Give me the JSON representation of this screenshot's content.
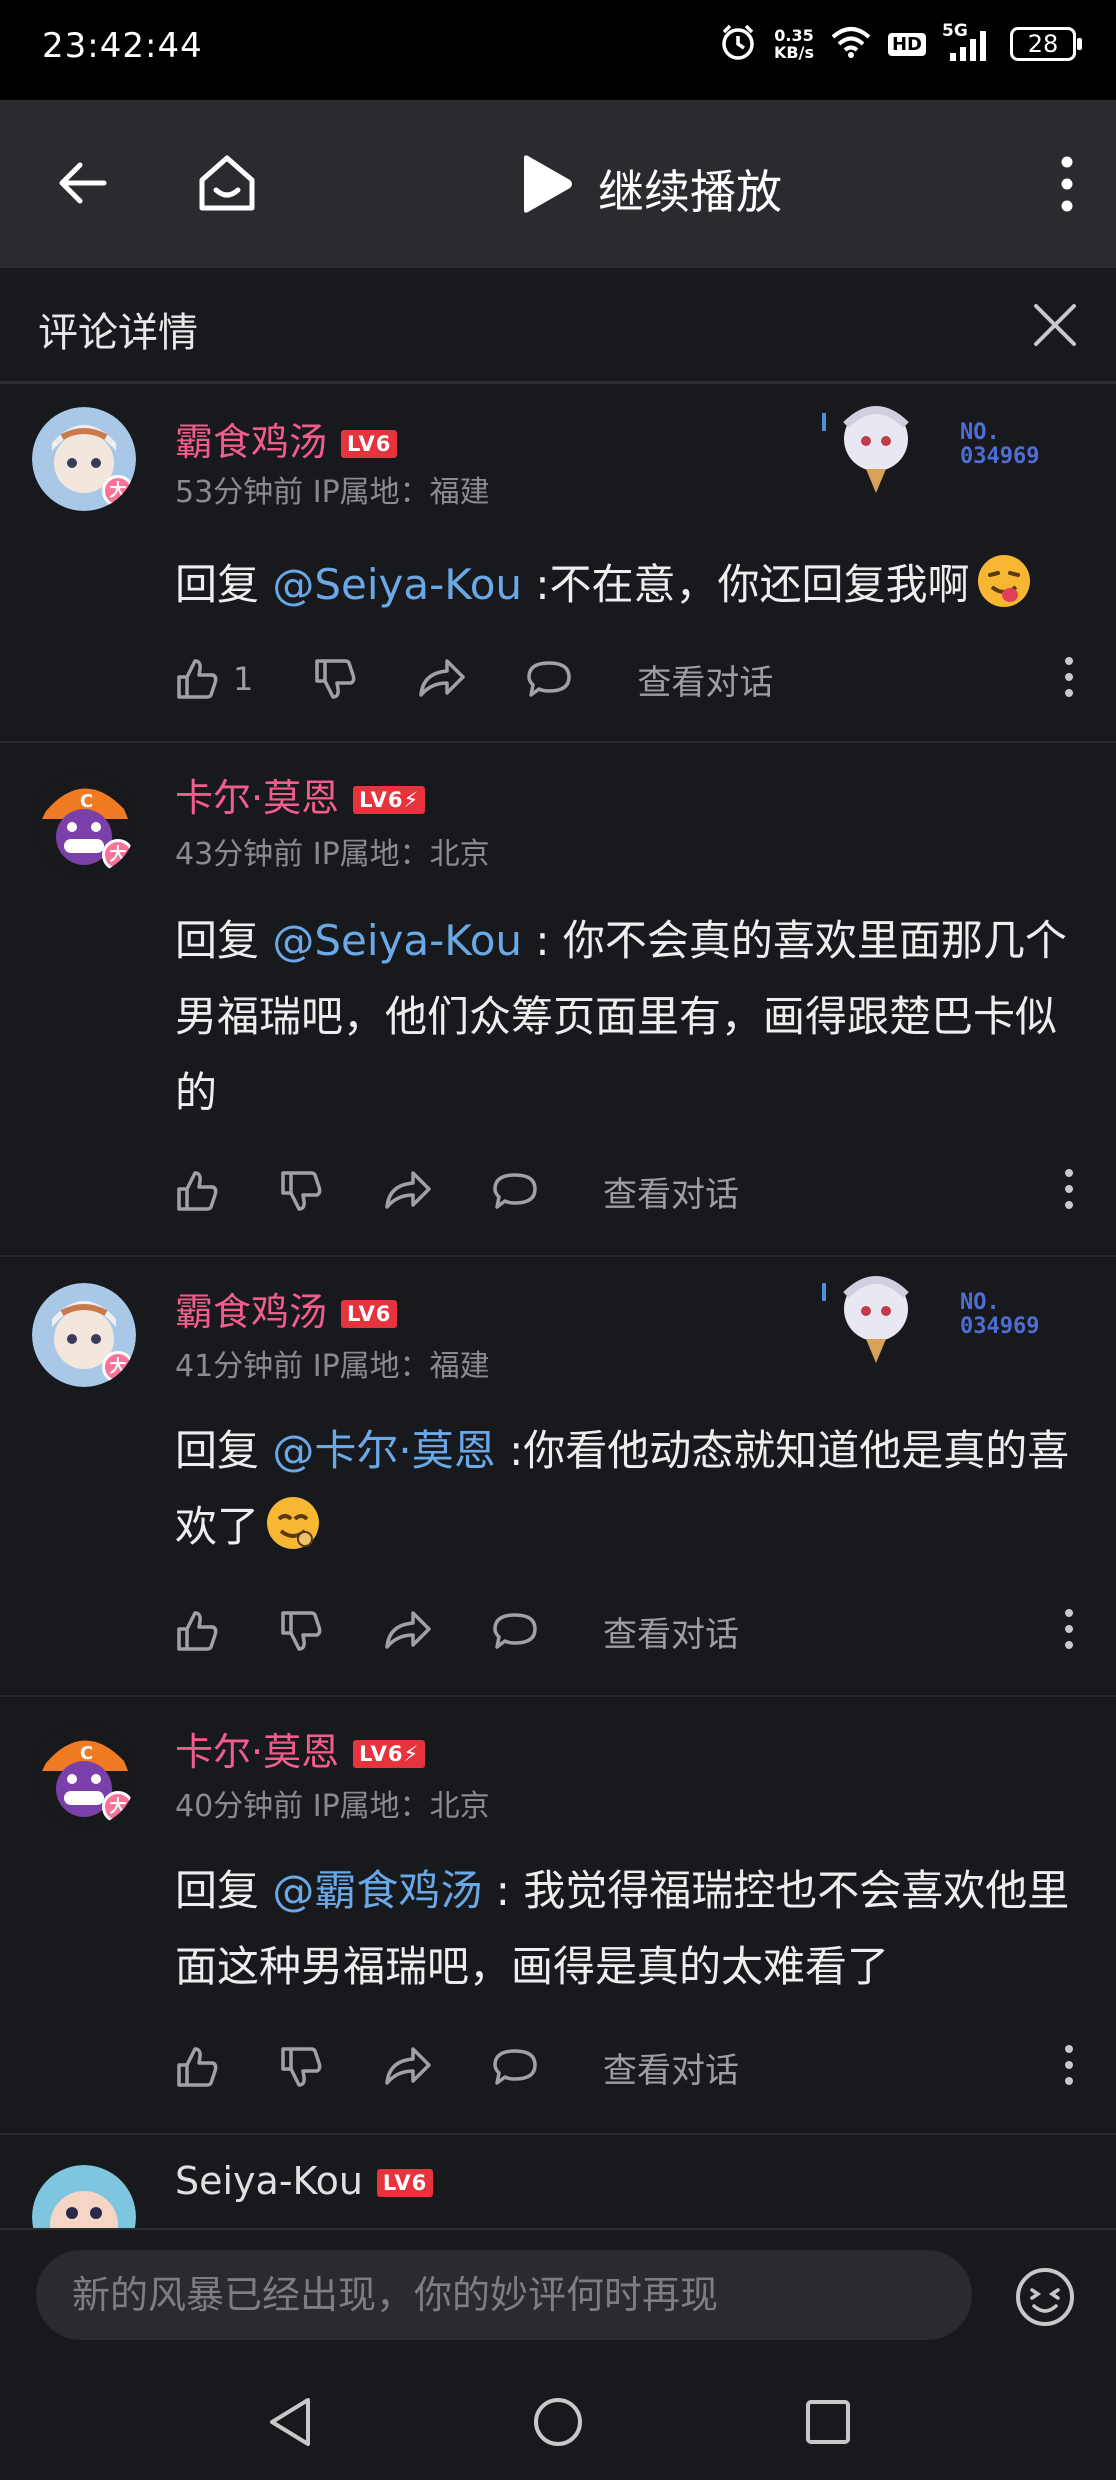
{
  "status_bar": {
    "time": "23:42:44",
    "net_speed_value": "0.35",
    "net_speed_unit": "KB/s",
    "hd": "HD",
    "signal": "5G",
    "battery": "28"
  },
  "top_bar": {
    "title": "继续播放"
  },
  "detail_header": {
    "label": "评论详情"
  },
  "comments": [
    {
      "username": "霸食鸡汤",
      "level": "LV6",
      "time": "53分钟前",
      "ip": "IP属地：福建",
      "reply_prefix": "回复 ",
      "mention": "@Seiya-Kou",
      "text": " :不在意，你还回复我啊",
      "likes": "1",
      "view_conversation": "查看对话",
      "pendant_no": "NO.\n034969",
      "avatar_badge": "大"
    },
    {
      "username": "卡尔·莫恩",
      "level": "LV6⚡",
      "time": "43分钟前",
      "ip": "IP属地：北京",
      "reply_prefix": "回复 ",
      "mention": "@Seiya-Kou",
      "text": " : 你不会真的喜欢里面那几个男福瑞吧，他们众筹页面里有，画得跟楚巴卡似的",
      "likes": "",
      "view_conversation": "查看对话",
      "avatar_badge": "大"
    },
    {
      "username": "霸食鸡汤",
      "level": "LV6",
      "time": "41分钟前",
      "ip": "IP属地：福建",
      "reply_prefix": "回复 ",
      "mention": "@卡尔·莫恩",
      "text": " :你看他动态就知道他是真的喜欢了",
      "likes": "",
      "view_conversation": "查看对话",
      "pendant_no": "NO.\n034969",
      "avatar_badge": "大"
    },
    {
      "username": "卡尔·莫恩",
      "level": "LV6⚡",
      "time": "40分钟前",
      "ip": "IP属地：北京",
      "reply_prefix": "回复 ",
      "mention": "@霸食鸡汤",
      "text": " : 我觉得福瑞控也不会喜欢他里面这种男福瑞吧，画得是真的太难看了",
      "likes": "",
      "view_conversation": "查看对话",
      "avatar_badge": "大"
    },
    {
      "username": "Seiya-Kou",
      "level": "LV6"
    }
  ],
  "bottom_input": {
    "placeholder": "新的风暴已经出现，你的妙评何时再现"
  },
  "colors": {
    "background": "#18191c",
    "username_pink": "#f25d8e",
    "mention_blue": "#6aa9e8",
    "level_red": "#e6343f"
  }
}
